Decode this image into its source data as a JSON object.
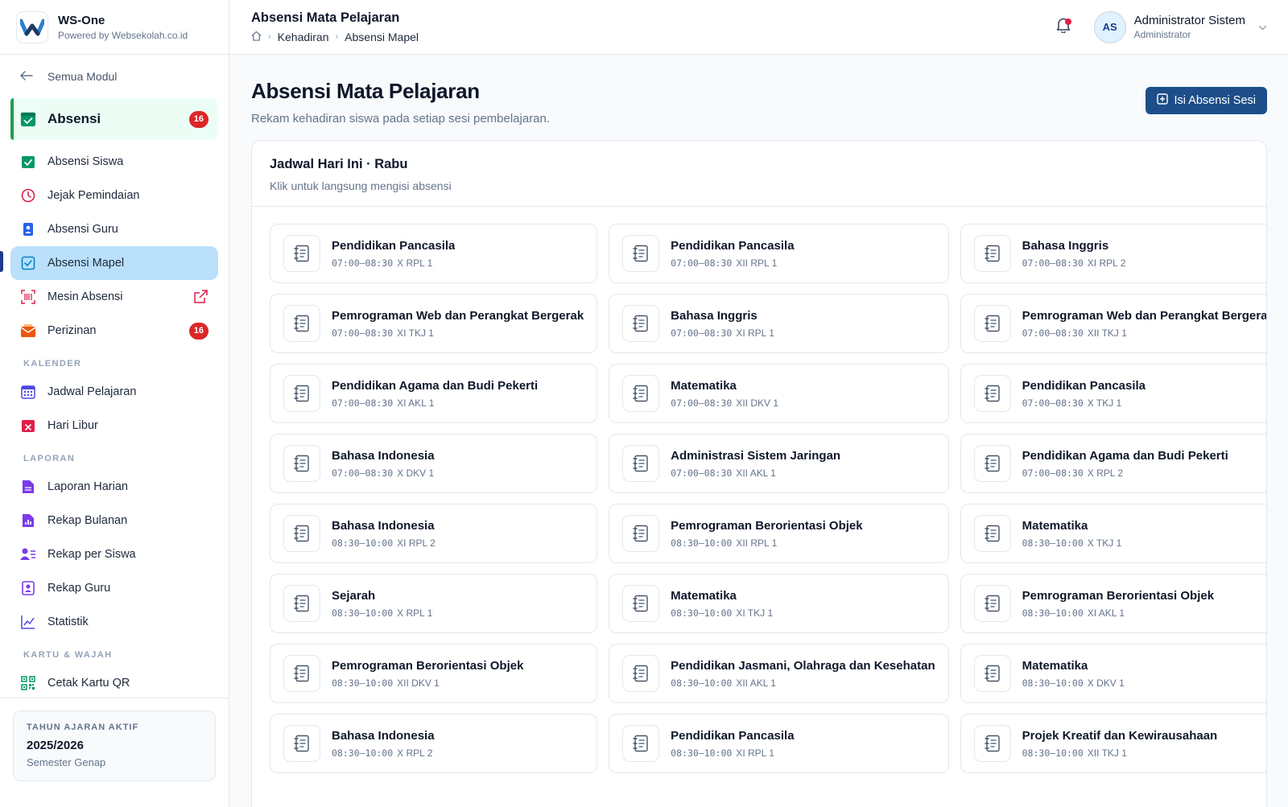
{
  "brand": {
    "title": "WS-One",
    "subtitle": "Powered by Websekolah.co.id"
  },
  "sidebar": {
    "back_label": "Semua Modul",
    "module": {
      "label": "Absensi",
      "badge": "16"
    },
    "items": [
      {
        "label": "Absensi Siswa",
        "icon": "calendar-check-icon",
        "color": "#059669"
      },
      {
        "label": "Jejak Pemindaian",
        "icon": "clock-icon",
        "color": "#e11d48"
      },
      {
        "label": "Absensi Guru",
        "icon": "id-badge-icon",
        "color": "#2563eb"
      },
      {
        "label": "Absensi Mapel",
        "icon": "checklist-icon",
        "color": "#0284c7"
      },
      {
        "label": "Mesin Absensi",
        "icon": "barcode-icon",
        "color": "#e11d48"
      },
      {
        "label": "Perizinan",
        "icon": "envelope-icon",
        "color": "#ea580c",
        "badge": "16"
      }
    ],
    "sections": [
      {
        "title": "KALENDER",
        "items": [
          {
            "label": "Jadwal Pelajaran",
            "icon": "calendar-grid-icon",
            "color": "#4f46e5"
          },
          {
            "label": "Hari Libur",
            "icon": "calendar-x-icon",
            "color": "#e11d48"
          }
        ]
      },
      {
        "title": "LAPORAN",
        "items": [
          {
            "label": "Laporan Harian",
            "icon": "document-icon",
            "color": "#7c3aed"
          },
          {
            "label": "Rekap Bulanan",
            "icon": "bar-chart-icon",
            "color": "#7c3aed"
          },
          {
            "label": "Rekap per Siswa",
            "icon": "user-list-icon",
            "color": "#7c3aed"
          },
          {
            "label": "Rekap Guru",
            "icon": "user-badge-icon",
            "color": "#7c3aed"
          },
          {
            "label": "Statistik",
            "icon": "line-chart-icon",
            "color": "#4f46e5"
          }
        ]
      },
      {
        "title": "KARTU & WAJAH",
        "items": [
          {
            "label": "Cetak Kartu QR",
            "icon": "qr-code-icon",
            "color": "#059669"
          }
        ]
      }
    ],
    "year_card": {
      "title": "TAHUN AJARAN AKTIF",
      "value": "2025/2026",
      "semester": "Semester Genap"
    }
  },
  "header": {
    "title": "Absensi Mata Pelajaran",
    "breadcrumb": [
      "Kehadiran",
      "Absensi Mapel"
    ],
    "user": {
      "initials": "AS",
      "name": "Administrator Sistem",
      "role": "Administrator"
    },
    "notification_color": "#e11d48"
  },
  "page": {
    "title": "Absensi Mata Pelajaran",
    "subtitle": "Rekam kehadiran siswa pada setiap sesi pembelajaran.",
    "primary_button": "Isi Absensi Sesi"
  },
  "schedule": {
    "title": "Jadwal Hari Ini · Rabu",
    "subtitle": "Klik untuk langsung mengisi absensi",
    "sessions": [
      {
        "subject": "Pendidikan Pancasila",
        "time": "07:00–08:30",
        "class": "X RPL 1"
      },
      {
        "subject": "Pendidikan Pancasila",
        "time": "07:00–08:30",
        "class": "XII RPL 1"
      },
      {
        "subject": "Bahasa Inggris",
        "time": "07:00–08:30",
        "class": "XI RPL 2"
      },
      {
        "subject": "Pemrograman Web dan Perangkat Bergerak",
        "time": "07:00–08:30",
        "class": "XI TKJ 1"
      },
      {
        "subject": "Bahasa Inggris",
        "time": "07:00–08:30",
        "class": "XI RPL 1"
      },
      {
        "subject": "Pemrograman Web dan Perangkat Bergerak",
        "time": "07:00–08:30",
        "class": "XII TKJ 1"
      },
      {
        "subject": "Pendidikan Agama dan Budi Pekerti",
        "time": "07:00–08:30",
        "class": "XI AKL 1"
      },
      {
        "subject": "Matematika",
        "time": "07:00–08:30",
        "class": "XII DKV 1"
      },
      {
        "subject": "Pendidikan Pancasila",
        "time": "07:00–08:30",
        "class": "X TKJ 1"
      },
      {
        "subject": "Bahasa Indonesia",
        "time": "07:00–08:30",
        "class": "X DKV 1"
      },
      {
        "subject": "Administrasi Sistem Jaringan",
        "time": "07:00–08:30",
        "class": "XII AKL 1"
      },
      {
        "subject": "Pendidikan Agama dan Budi Pekerti",
        "time": "07:00–08:30",
        "class": "X RPL 2"
      },
      {
        "subject": "Bahasa Indonesia",
        "time": "08:30–10:00",
        "class": "XI RPL 2"
      },
      {
        "subject": "Pemrograman Berorientasi Objek",
        "time": "08:30–10:00",
        "class": "XII RPL 1"
      },
      {
        "subject": "Matematika",
        "time": "08:30–10:00",
        "class": "X TKJ 1"
      },
      {
        "subject": "Sejarah",
        "time": "08:30–10:00",
        "class": "X RPL 1"
      },
      {
        "subject": "Matematika",
        "time": "08:30–10:00",
        "class": "XI TKJ 1"
      },
      {
        "subject": "Pemrograman Berorientasi Objek",
        "time": "08:30–10:00",
        "class": "XI AKL 1"
      },
      {
        "subject": "Pemrograman Berorientasi Objek",
        "time": "08:30–10:00",
        "class": "XII DKV 1"
      },
      {
        "subject": "Pendidikan Jasmani, Olahraga dan Kesehatan",
        "time": "08:30–10:00",
        "class": "XII AKL 1"
      },
      {
        "subject": "Matematika",
        "time": "08:30–10:00",
        "class": "X DKV 1"
      },
      {
        "subject": "Bahasa Indonesia",
        "time": "08:30–10:00",
        "class": "X RPL 2"
      },
      {
        "subject": "Pendidikan Pancasila",
        "time": "08:30–10:00",
        "class": "XI RPL 1"
      },
      {
        "subject": "Projek Kreatif dan Kewirausahaan",
        "time": "08:30–10:00",
        "class": "XII TKJ 1"
      }
    ]
  }
}
